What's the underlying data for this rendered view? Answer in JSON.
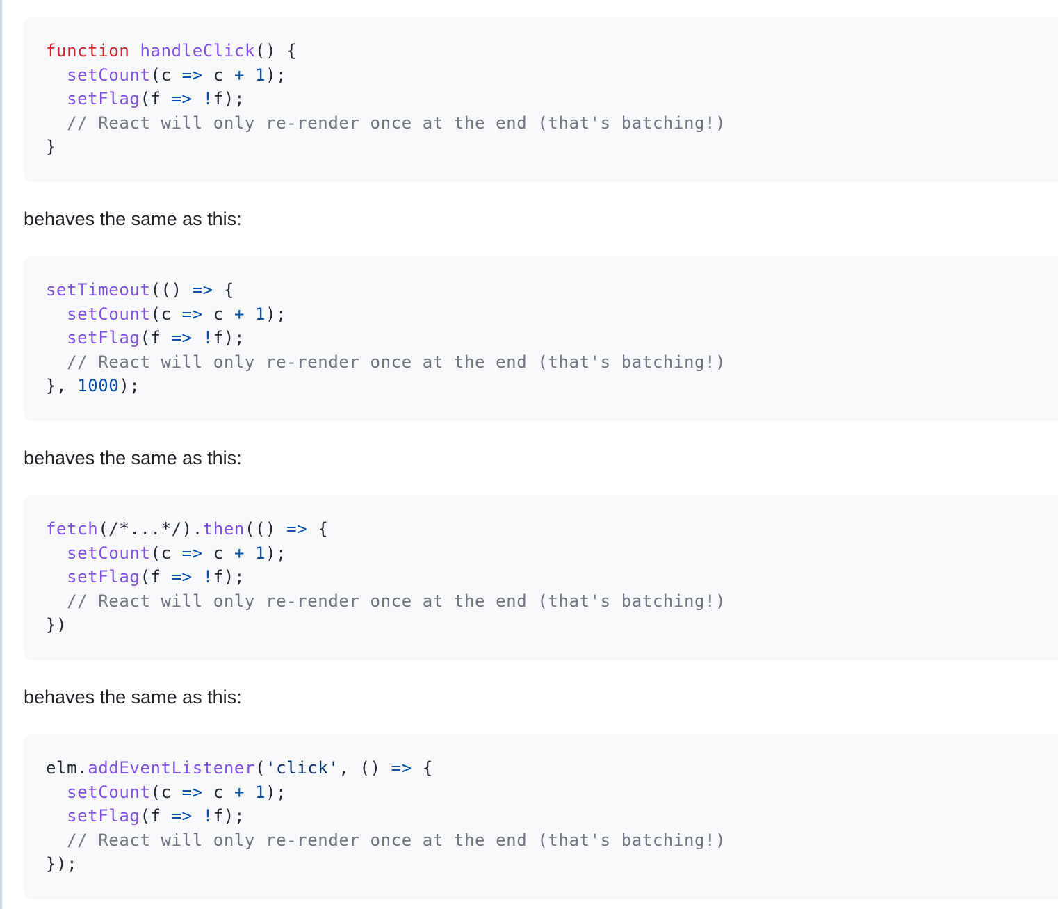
{
  "paragraphs": [
    "behaves the same as this:",
    "behaves the same as this:",
    "behaves the same as this:"
  ],
  "code_blocks": [
    {
      "lines": [
        [
          {
            "t": "function",
            "c": "keyword"
          },
          {
            "t": " ",
            "c": "plain"
          },
          {
            "t": "handleClick",
            "c": "fn"
          },
          {
            "t": "() {",
            "c": "plain"
          }
        ],
        [
          {
            "t": "  ",
            "c": "plain"
          },
          {
            "t": "setCount",
            "c": "fn"
          },
          {
            "t": "(c ",
            "c": "plain"
          },
          {
            "t": "=>",
            "c": "op"
          },
          {
            "t": " c ",
            "c": "plain"
          },
          {
            "t": "+",
            "c": "op"
          },
          {
            "t": " ",
            "c": "plain"
          },
          {
            "t": "1",
            "c": "num"
          },
          {
            "t": ");",
            "c": "plain"
          }
        ],
        [
          {
            "t": "  ",
            "c": "plain"
          },
          {
            "t": "setFlag",
            "c": "fn"
          },
          {
            "t": "(f ",
            "c": "plain"
          },
          {
            "t": "=>",
            "c": "op"
          },
          {
            "t": " ",
            "c": "plain"
          },
          {
            "t": "!",
            "c": "op"
          },
          {
            "t": "f);",
            "c": "plain"
          }
        ],
        [
          {
            "t": "  // React will only re-render once at the end (that's batching!)",
            "c": "comment"
          }
        ],
        [
          {
            "t": "}",
            "c": "plain"
          }
        ]
      ]
    },
    {
      "lines": [
        [
          {
            "t": "setTimeout",
            "c": "fn"
          },
          {
            "t": "(() ",
            "c": "plain"
          },
          {
            "t": "=>",
            "c": "op"
          },
          {
            "t": " {",
            "c": "plain"
          }
        ],
        [
          {
            "t": "  ",
            "c": "plain"
          },
          {
            "t": "setCount",
            "c": "fn"
          },
          {
            "t": "(c ",
            "c": "plain"
          },
          {
            "t": "=>",
            "c": "op"
          },
          {
            "t": " c ",
            "c": "plain"
          },
          {
            "t": "+",
            "c": "op"
          },
          {
            "t": " ",
            "c": "plain"
          },
          {
            "t": "1",
            "c": "num"
          },
          {
            "t": ");",
            "c": "plain"
          }
        ],
        [
          {
            "t": "  ",
            "c": "plain"
          },
          {
            "t": "setFlag",
            "c": "fn"
          },
          {
            "t": "(f ",
            "c": "plain"
          },
          {
            "t": "=>",
            "c": "op"
          },
          {
            "t": " ",
            "c": "plain"
          },
          {
            "t": "!",
            "c": "op"
          },
          {
            "t": "f);",
            "c": "plain"
          }
        ],
        [
          {
            "t": "  // React will only re-render once at the end (that's batching!)",
            "c": "comment"
          }
        ],
        [
          {
            "t": "}, ",
            "c": "plain"
          },
          {
            "t": "1000",
            "c": "num"
          },
          {
            "t": ");",
            "c": "plain"
          }
        ]
      ]
    },
    {
      "lines": [
        [
          {
            "t": "fetch",
            "c": "fn"
          },
          {
            "t": "(/*...*/).",
            "c": "plain"
          },
          {
            "t": "then",
            "c": "fn"
          },
          {
            "t": "(() ",
            "c": "plain"
          },
          {
            "t": "=>",
            "c": "op"
          },
          {
            "t": " {",
            "c": "plain"
          }
        ],
        [
          {
            "t": "  ",
            "c": "plain"
          },
          {
            "t": "setCount",
            "c": "fn"
          },
          {
            "t": "(c ",
            "c": "plain"
          },
          {
            "t": "=>",
            "c": "op"
          },
          {
            "t": " c ",
            "c": "plain"
          },
          {
            "t": "+",
            "c": "op"
          },
          {
            "t": " ",
            "c": "plain"
          },
          {
            "t": "1",
            "c": "num"
          },
          {
            "t": ");",
            "c": "plain"
          }
        ],
        [
          {
            "t": "  ",
            "c": "plain"
          },
          {
            "t": "setFlag",
            "c": "fn"
          },
          {
            "t": "(f ",
            "c": "plain"
          },
          {
            "t": "=>",
            "c": "op"
          },
          {
            "t": " ",
            "c": "plain"
          },
          {
            "t": "!",
            "c": "op"
          },
          {
            "t": "f);",
            "c": "plain"
          }
        ],
        [
          {
            "t": "  // React will only re-render once at the end (that's batching!)",
            "c": "comment"
          }
        ],
        [
          {
            "t": "})",
            "c": "plain"
          }
        ]
      ]
    },
    {
      "lines": [
        [
          {
            "t": "elm.",
            "c": "plain"
          },
          {
            "t": "addEventListener",
            "c": "fn"
          },
          {
            "t": "(",
            "c": "plain"
          },
          {
            "t": "'click'",
            "c": "str"
          },
          {
            "t": ", () ",
            "c": "plain"
          },
          {
            "t": "=>",
            "c": "op"
          },
          {
            "t": " {",
            "c": "plain"
          }
        ],
        [
          {
            "t": "  ",
            "c": "plain"
          },
          {
            "t": "setCount",
            "c": "fn"
          },
          {
            "t": "(c ",
            "c": "plain"
          },
          {
            "t": "=>",
            "c": "op"
          },
          {
            "t": " c ",
            "c": "plain"
          },
          {
            "t": "+",
            "c": "op"
          },
          {
            "t": " ",
            "c": "plain"
          },
          {
            "t": "1",
            "c": "num"
          },
          {
            "t": ");",
            "c": "plain"
          }
        ],
        [
          {
            "t": "  ",
            "c": "plain"
          },
          {
            "t": "setFlag",
            "c": "fn"
          },
          {
            "t": "(f ",
            "c": "plain"
          },
          {
            "t": "=>",
            "c": "op"
          },
          {
            "t": " ",
            "c": "plain"
          },
          {
            "t": "!",
            "c": "op"
          },
          {
            "t": "f);",
            "c": "plain"
          }
        ],
        [
          {
            "t": "  // React will only re-render once at the end (that's batching!)",
            "c": "comment"
          }
        ],
        [
          {
            "t": "});",
            "c": "plain"
          }
        ]
      ]
    }
  ]
}
